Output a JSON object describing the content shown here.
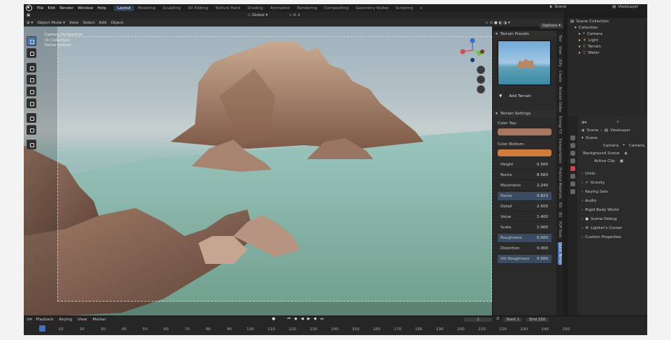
{
  "topbar": {
    "menus": [
      "File",
      "Edit",
      "Render",
      "Window",
      "Help"
    ],
    "tabs": [
      "Layout",
      "Modeling",
      "Sculpting",
      "UV Editing",
      "Texture Paint",
      "Shading",
      "Animation",
      "Rendering",
      "Compositing",
      "Geometry Nodes",
      "Scripting"
    ],
    "active_tab": "Layout",
    "plus": "+",
    "scene": "Scene",
    "view_layer": "ViewLayer"
  },
  "header": {
    "mode": "Object Mode",
    "menus": [
      "View",
      "Select",
      "Add",
      "Object"
    ],
    "transform": "Global"
  },
  "viewport": {
    "camera_info": [
      "Camera Perspective",
      "(1) Collection",
      "Factor system"
    ],
    "options": "Options",
    "gizmo": {
      "x_color": "#d64a4a",
      "y_color": "#6bbf3a",
      "z_color": "#3a6bd6"
    }
  },
  "npanel": {
    "presets_title": "Terrain Presets",
    "add_terrain": "Add Terrain",
    "settings_title": "Terrain Settings",
    "color_top_label": "Color Top:",
    "color_top": "#a87660",
    "color_bottom_label": "Color Bottom:",
    "color_bottom": "#d07c3c",
    "rows": [
      {
        "label": "Height",
        "value": "0.500",
        "highlight": false
      },
      {
        "label": "Rocks",
        "value": "8.560",
        "highlight": false
      },
      {
        "label": "Mountains",
        "value": "2.240",
        "highlight": false
      },
      {
        "label": "Factor",
        "value": "0.823",
        "highlight": true
      },
      {
        "label": "Detail",
        "value": "2.500",
        "highlight": false
      },
      {
        "label": "Value",
        "value": "1.400",
        "highlight": false
      },
      {
        "label": "Scale",
        "value": "1.000",
        "highlight": false
      },
      {
        "label": "Roughness",
        "value": "0.500",
        "highlight": true
      },
      {
        "label": "Distortion",
        "value": "0.000",
        "highlight": false
      },
      {
        "label": "Hill Roughness",
        "value": "0.500",
        "highlight": true
      }
    ]
  },
  "vtabs": [
    "Tool",
    "View",
    "3Dfy",
    "Create",
    "Aviation Slides",
    "Energy FX",
    "Transportation",
    "Practice Materials",
    "RD",
    "BG",
    "PUP Tools",
    "Quick Terrain"
  ],
  "active_vtab": "Quick Terrain",
  "outliner": {
    "root": "Scene Collection",
    "collection": "Collection",
    "items": [
      "Camera",
      "Light",
      "Terrain",
      "Water"
    ]
  },
  "properties": {
    "breadcrumb": [
      "Scene",
      "ViewLayer"
    ],
    "section": "Scene",
    "camera_label": "Camera",
    "camera_value": "Camera",
    "background_scene_label": "Background Scene",
    "active_clip_label": "Active Clip",
    "panels": [
      "Units",
      "Gravity",
      "Keying Sets",
      "Audio",
      "Rigid Body World",
      "Scene Debug",
      "Lighter's Corner",
      "Custom Properties"
    ]
  },
  "timeline": {
    "menus": [
      "Playback",
      "Keying",
      "View",
      "Marker"
    ],
    "current_frame": "1",
    "start_label": "Start",
    "start": "1",
    "end_label": "End",
    "end": "250",
    "ruler": [
      "1",
      "10",
      "20",
      "30",
      "40",
      "50",
      "60",
      "70",
      "80",
      "90",
      "100",
      "110",
      "120",
      "130",
      "140",
      "150",
      "160",
      "170",
      "180",
      "190",
      "200",
      "210",
      "220",
      "230",
      "240",
      "250"
    ]
  }
}
